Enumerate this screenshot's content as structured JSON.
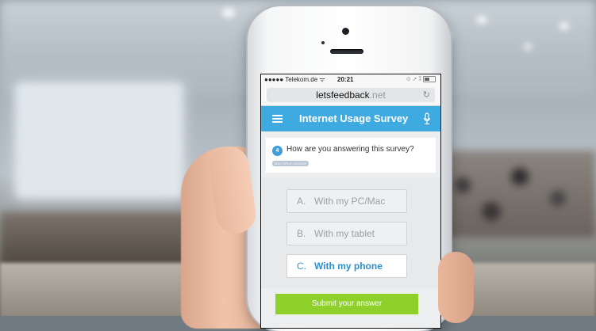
{
  "status_bar": {
    "carrier": "●●●●● Telekom.de ᯤ",
    "time": "20:21",
    "indicators": "⊙ ➚ ⁑"
  },
  "browser": {
    "url_main": "letsfeedback",
    "url_tld": ".net",
    "reload_icon": "↻"
  },
  "app": {
    "title": "Internet Usage Survey",
    "theme_color": "#3eaadf"
  },
  "question": {
    "number": "4",
    "text": "How are you answering this survey?",
    "type_badge": "MULTIPLE CHOICE"
  },
  "options": [
    {
      "letter": "A.",
      "label": "With my PC/Mac",
      "selected": false
    },
    {
      "letter": "B.",
      "label": "With my tablet",
      "selected": false
    },
    {
      "letter": "C.",
      "label": "With my phone",
      "selected": true
    }
  ],
  "submit_label": "Submit your answer",
  "colors": {
    "accent": "#3eaadf",
    "submit": "#8ed12a",
    "selected_text": "#2f8fcc"
  }
}
